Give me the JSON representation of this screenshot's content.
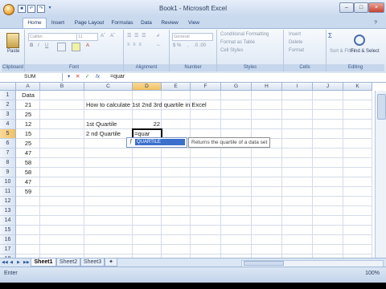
{
  "window": {
    "title": "Book1 - Microsoft Excel",
    "controls": [
      "–",
      "□",
      "×"
    ]
  },
  "tabs": [
    "Home",
    "Insert",
    "Page Layout",
    "Formulas",
    "Data",
    "Review",
    "View"
  ],
  "ribbon": {
    "groups": [
      "Clipboard",
      "Font",
      "Alignment",
      "Number",
      "Styles",
      "Cells",
      "Editing"
    ],
    "paste_label": "Paste",
    "font_name": "Calibri",
    "font_size": "11",
    "number_format": "General",
    "styles_items": [
      "Conditional Formatting",
      "Format as Table",
      "Cell Styles"
    ],
    "cells_items": [
      "Insert",
      "Delete",
      "Format"
    ],
    "editing_items": [
      "Sort & Filter",
      "Find & Select"
    ]
  },
  "formula_bar": {
    "name_box": "SUM",
    "fx": "fx",
    "formula": "=quar"
  },
  "columns": [
    "A",
    "B",
    "C",
    "D",
    "E",
    "F",
    "G",
    "H",
    "I",
    "J",
    "K"
  ],
  "rows": [
    "1",
    "2",
    "3",
    "4",
    "5",
    "6",
    "7",
    "8",
    "9",
    "10",
    "11",
    "12",
    "13",
    "14",
    "15",
    "16",
    "17",
    "18"
  ],
  "cells": {
    "A1": "Data",
    "A2": "21",
    "A3": "25",
    "A4": "12",
    "A5": "15",
    "A6": "25",
    "A7": "47",
    "A8": "58",
    "A9": "58",
    "A10": "47",
    "A11": "59",
    "C2": "How to calculate 1st 2nd 3rd quartile in Excel",
    "C4": "1st Quartile",
    "D4": "22",
    "C5": "2 nd Quartile",
    "D5": "=quar"
  },
  "autocomplete": {
    "item": "QUARTILE",
    "tooltip": "Returns the quartile of a data set"
  },
  "sheets": [
    "Sheet1",
    "Sheet2",
    "Sheet3"
  ],
  "status": {
    "mode": "Enter",
    "zoom": "100%"
  },
  "colors": {
    "ribbon_blue": "#c9d9ee",
    "selection_orange": "#f1c15f",
    "autocomplete_blue": "#3a6fcd"
  }
}
